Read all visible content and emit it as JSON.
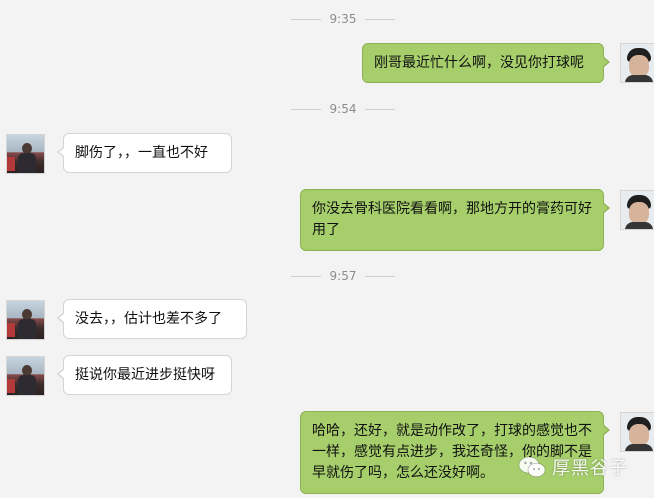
{
  "timestamps": [
    "9:35",
    "9:54",
    "9:57"
  ],
  "messages": [
    {
      "side": "right",
      "text": "刚哥最近忙什么啊，没见你打球呢"
    },
    {
      "side": "left",
      "text": "脚伤了，，一直也不好"
    },
    {
      "side": "right",
      "text": "你没去骨科医院看看啊，那地方开的膏药可好用了"
    },
    {
      "side": "left",
      "text": "没去，，估计也差不多了"
    },
    {
      "side": "left",
      "text": "挺说你最近进步挺快呀"
    },
    {
      "side": "right",
      "text": "哈哈，还好，就是动作改了，打球的感觉也不一样，感觉有点进步，我还奇怪，你的脚不是早就伤了吗，怎么还没好啊。"
    }
  ],
  "watermark": {
    "text": "厚黑谷子",
    "icon": "wechat-icon"
  },
  "colors": {
    "background": "#f3f3f3",
    "bubble_sent": "#a6cf6c",
    "bubble_received": "#ffffff"
  }
}
